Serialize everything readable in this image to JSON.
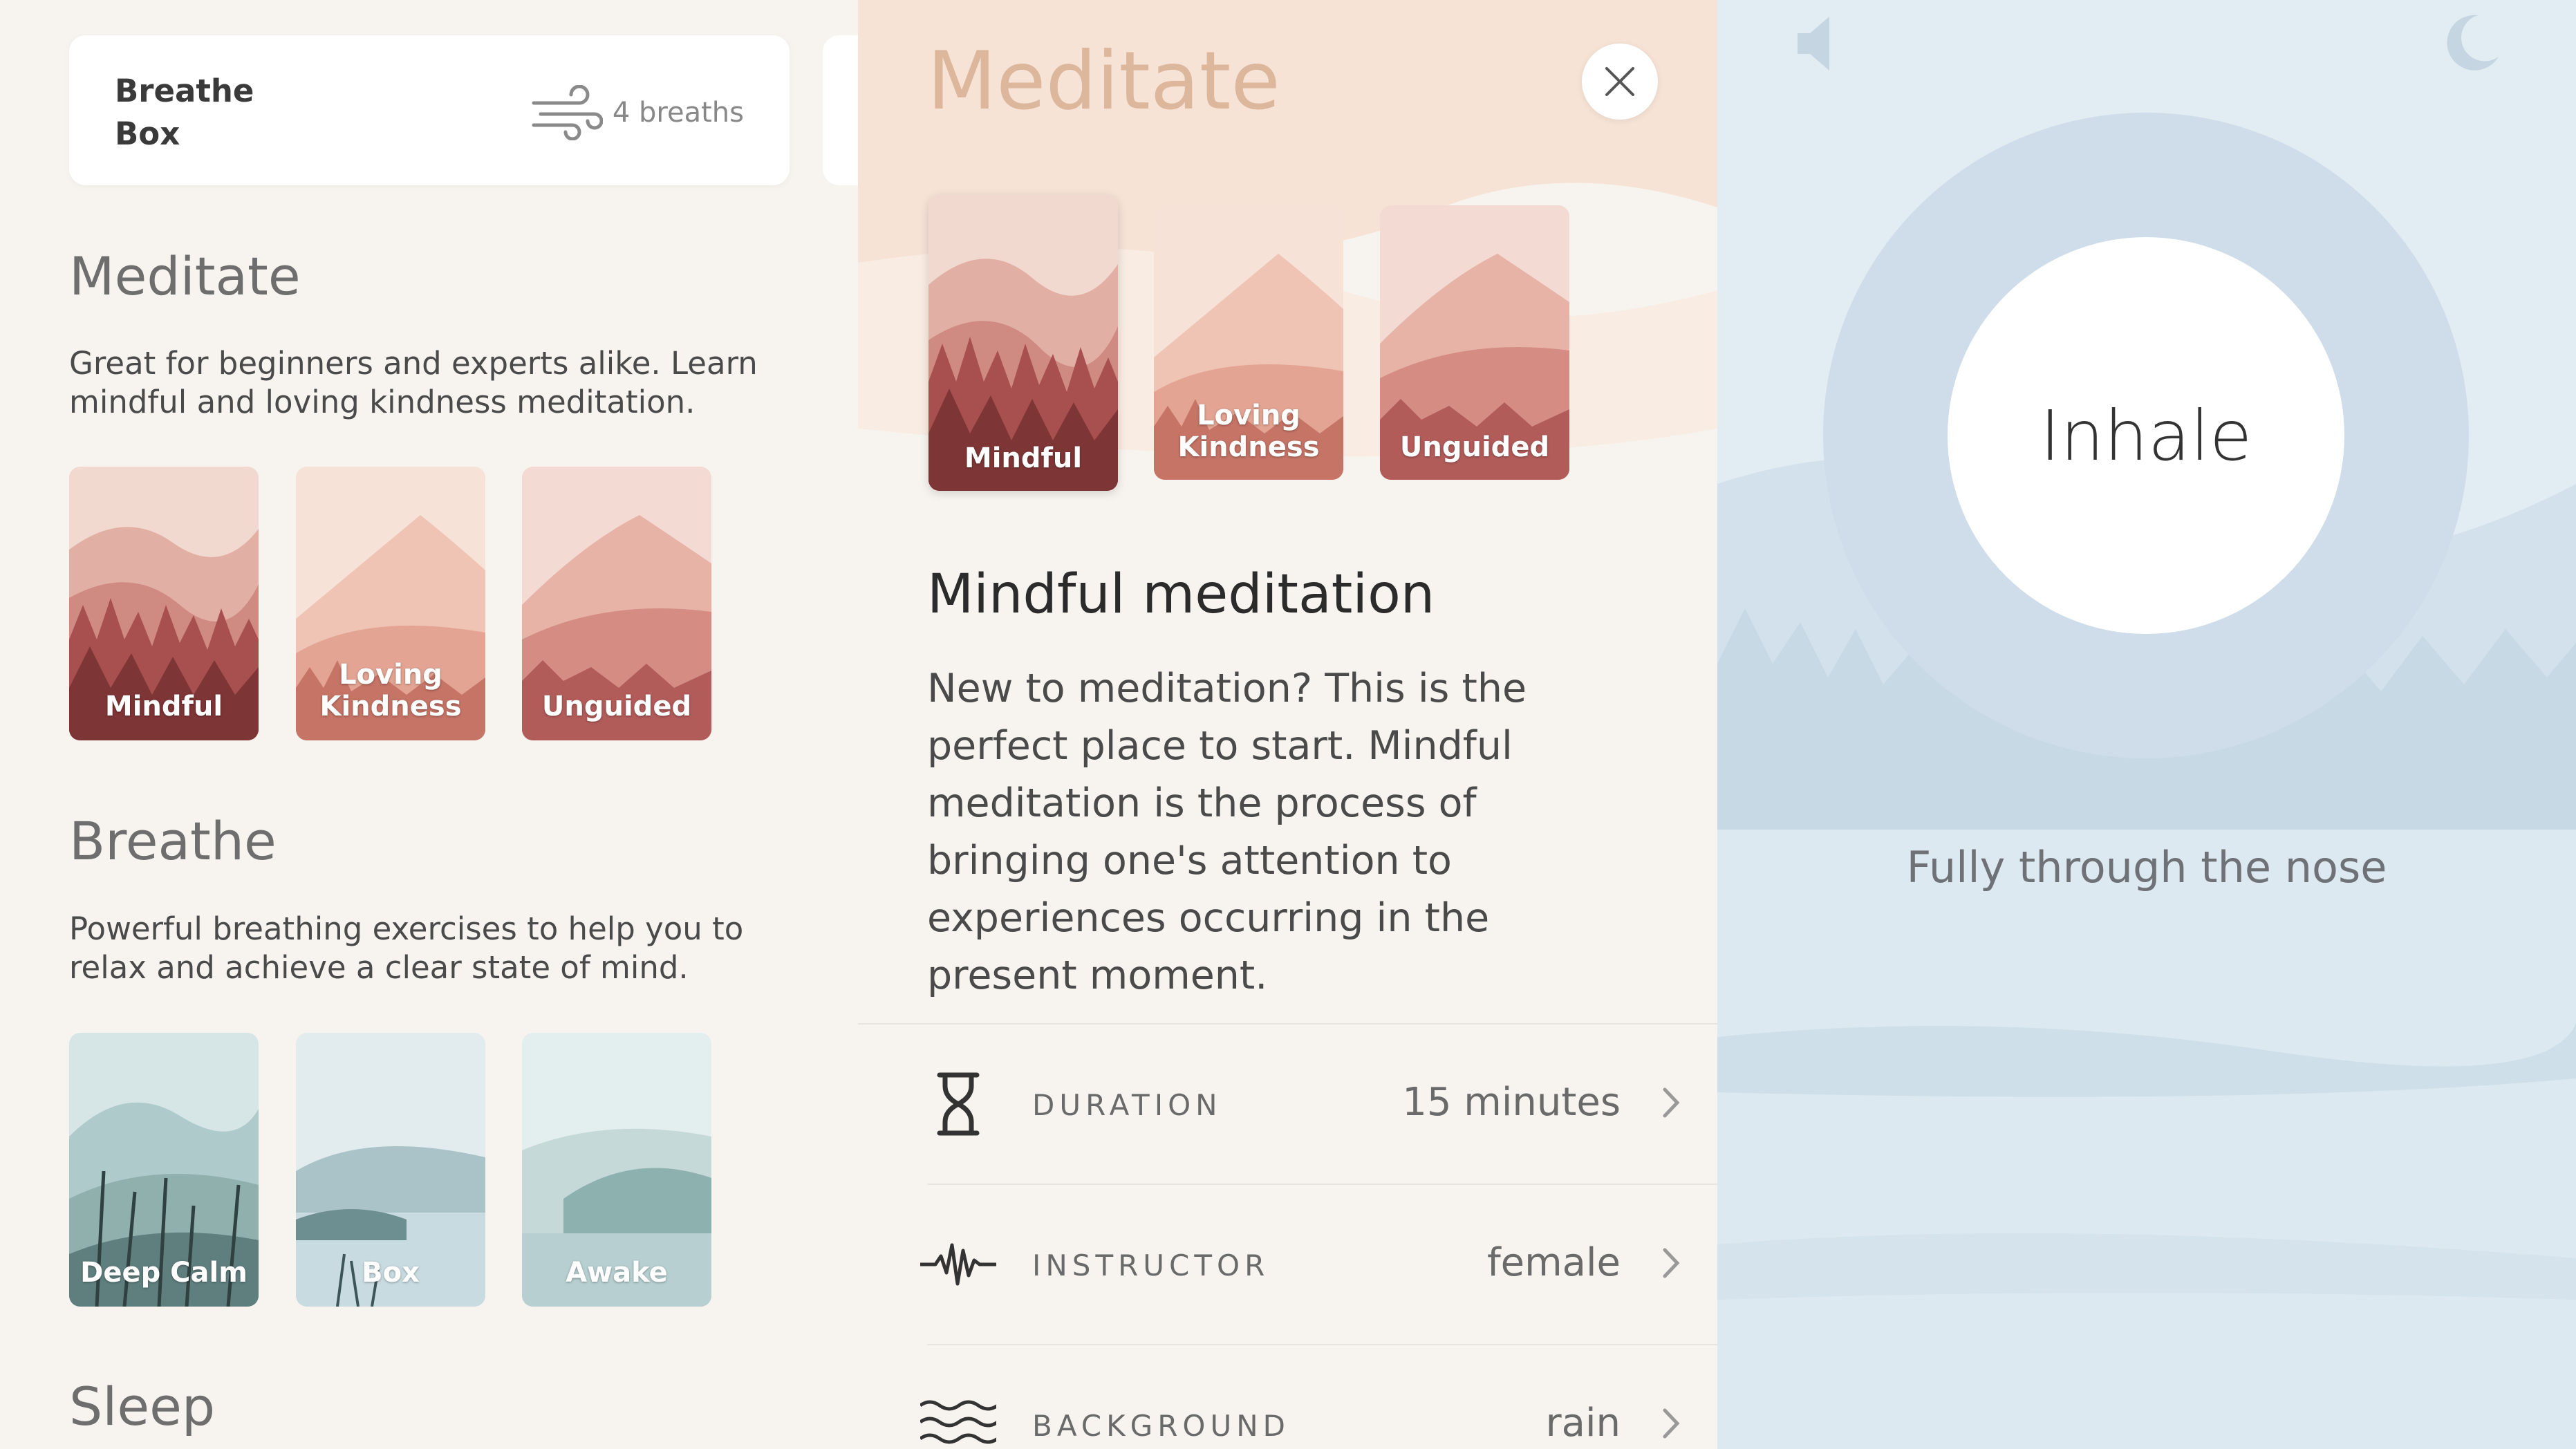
{
  "recent": {
    "title": "Breathe Box",
    "count": "4 breaths"
  },
  "meditate_section": {
    "title": "Meditate",
    "description": "Great for beginners and experts alike. Learn mindful and loving kindness meditation.",
    "tiles": [
      "Mindful",
      "Loving Kindness",
      "Unguided"
    ]
  },
  "breathe_section": {
    "title": "Breathe",
    "description": "Powerful breathing exercises to help you to relax and achieve a clear state of mind.",
    "tiles": [
      "Deep Calm",
      "Box",
      "Awake"
    ]
  },
  "sleep_section": {
    "title": "Sleep"
  },
  "detail": {
    "header": "Meditate",
    "tiles": [
      "Mindful",
      "Loving Kindness",
      "Unguided"
    ],
    "title": "Mindful meditation",
    "description": "New to meditation? This is the perfect place to start. Mindful meditation is the process of bringing one's attention to experiences occurring in the present moment.",
    "settings": [
      {
        "key": "DURATION",
        "value": "15 minutes",
        "icon": "hourglass-icon"
      },
      {
        "key": "INSTRUCTOR",
        "value": "female",
        "icon": "waveform-icon"
      },
      {
        "key": "BACKGROUND",
        "value": "rain",
        "icon": "waves-icon"
      }
    ]
  },
  "session": {
    "phase": "Inhale",
    "hint": "Fully through the nose"
  },
  "colors": {
    "meditate_accent": "#ddb79b",
    "meditate_tile": "#b86a66",
    "breathe_tile": "#8aaeb0",
    "breath_ring": "#cedde9",
    "session_bg": "#dde9f2"
  }
}
